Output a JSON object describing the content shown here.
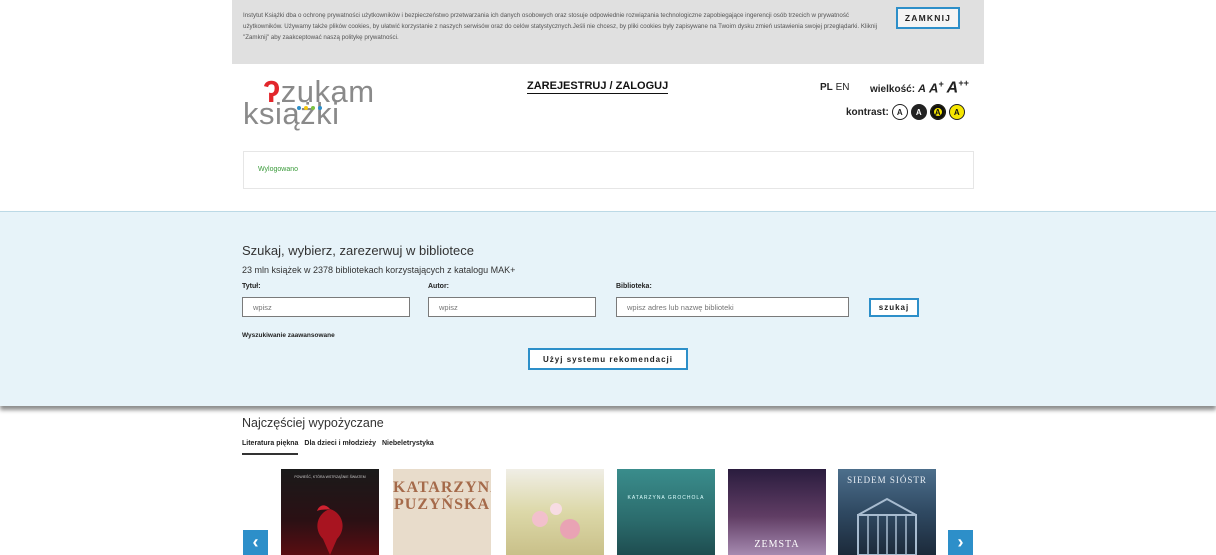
{
  "cookie": {
    "text": "Instytut Książki dba o ochronę prywatności użytkowników i bezpieczeństwo przetwarzania ich danych osobowych oraz stosuje odpowiednie rozwiązania technologiczne zapobiegające ingerencji osób trzecich w prywatność użytkowników. Używamy także plików cookies, by ułatwić korzystanie z naszych serwisów oraz do celów statystycznych.Jeśli nie chcesz, by pliki cookies były zapisywane na Twoim dysku zmień ustawienia swojej przeglądarki. Kliknij \"Zamknij\" aby zaakceptować naszą politykę prywatności.",
    "close_label": "ZAMKNIJ"
  },
  "header": {
    "logo_top_rest": "zukam",
    "logo_q": "ʔ",
    "logo_bottom": "książki",
    "login_label": "ZAREJESTRUJ / ZALOGUJ",
    "lang_pl": "PL",
    "lang_en": "EN",
    "size_label": "wielkość:",
    "size_small": "A",
    "size_medium": "A",
    "size_medium_sup": "+",
    "size_large": "A",
    "size_large_sup": "++",
    "contrast_label": "kontrast:",
    "contrast_options": [
      "A",
      "A",
      "A",
      "A"
    ],
    "colors": {
      "logo_red": "#e2262b",
      "dot_1": "#2d8fc9",
      "dot_2": "#f6c811",
      "dot_3": "#7cc242",
      "dot_4": "#2d8fc9"
    }
  },
  "status": {
    "text": "Wylogowano"
  },
  "search": {
    "title": "Szukaj, wybierz, zarezerwuj w bibliotece",
    "subtitle": "23 mln książek w 2378 bibliotekach korzystających z katalogu MAK+",
    "title_label": "Tytuł:",
    "title_placeholder": "wpisz",
    "author_label": "Autor:",
    "author_placeholder": "wpisz",
    "library_label": "Biblioteka:",
    "library_placeholder": "wpisz adres lub nazwę biblioteki",
    "search_button": "szukaj",
    "advanced_link": "Wyszukiwanie zaawansowane",
    "recommend_button": "Użyj systemu rekomendacji",
    "accent_color": "#2d8fc9"
  },
  "popular": {
    "title": "Najczęściej wypożyczane",
    "tabs": [
      "Literatura piękna",
      "Dla dzieci i młodzieży",
      "Niebeletrystyka"
    ],
    "books": [
      {
        "cover_text": "POWIEŚĆ, KTÓRA WSTRZĄŚNIE ŚWIATEM"
      },
      {
        "cover_text": "KATARZYNA PUZYŃSKA"
      },
      {
        "cover_text": ""
      },
      {
        "cover_text": "KATARZYNA GROCHOLA"
      },
      {
        "cover_text": "ZEMSTA"
      },
      {
        "cover_text": "SIEDEM SIÓSTR"
      }
    ],
    "prev_arrow": "‹",
    "next_arrow": "›"
  }
}
